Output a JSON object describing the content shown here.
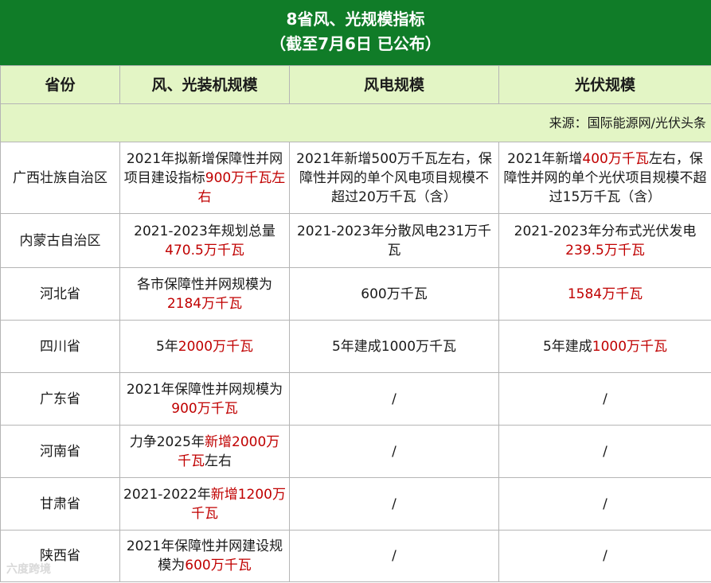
{
  "title_line1": "8省风、光规模指标",
  "title_line2": "（截至7月6日 已公布）",
  "columns": [
    "省份",
    "风、光装机规模",
    "风电规模",
    "光伏规模"
  ],
  "source": "来源：国际能源网/光伏头条",
  "rows": [
    {
      "province": "广西壮族自治区",
      "total": [
        {
          "t": "2021年拟新增保障性并网项目建设指标"
        },
        {
          "t": "900万千瓦左右",
          "red": true
        }
      ],
      "wind": [
        {
          "t": "2021年新增500万千瓦左右，保障性并网的单个风电项目规模不超过20万千瓦（含）"
        }
      ],
      "solar": [
        {
          "t": "2021年新增"
        },
        {
          "t": "400万千瓦",
          "red": true
        },
        {
          "t": "左右，保障性并网的单个光伏项目规模不超过15万千瓦（含）"
        }
      ]
    },
    {
      "province": "内蒙古自治区",
      "total": [
        {
          "t": "2021-2023年规划总量"
        },
        {
          "t": "470.5万千瓦",
          "red": true
        }
      ],
      "wind": [
        {
          "t": "2021-2023年分散风电231万千瓦"
        }
      ],
      "solar": [
        {
          "t": "2021-2023年分布式光伏发电"
        },
        {
          "t": "239.5万千瓦",
          "red": true
        }
      ]
    },
    {
      "province": "河北省",
      "total": [
        {
          "t": "各市保障性并网规模为"
        },
        {
          "t": "2184万千瓦",
          "red": true
        }
      ],
      "wind": [
        {
          "t": "600万千瓦"
        }
      ],
      "solar": [
        {
          "t": "1584万千瓦",
          "red": true
        }
      ]
    },
    {
      "province": "四川省",
      "total": [
        {
          "t": "5年"
        },
        {
          "t": "2000万千瓦",
          "red": true
        }
      ],
      "wind": [
        {
          "t": "5年建成1000万千瓦"
        }
      ],
      "solar": [
        {
          "t": "5年建成"
        },
        {
          "t": "1000万千瓦",
          "red": true
        }
      ]
    },
    {
      "province": "广东省",
      "total": [
        {
          "t": "2021年保障性并网规模为"
        },
        {
          "t": "900万千瓦",
          "red": true
        }
      ],
      "wind": [
        {
          "t": "/"
        }
      ],
      "solar": [
        {
          "t": "/"
        }
      ]
    },
    {
      "province": "河南省",
      "total": [
        {
          "t": "力争2025年"
        },
        {
          "t": "新增2000万千瓦",
          "red": true
        },
        {
          "t": "左右"
        }
      ],
      "wind": [
        {
          "t": "/"
        }
      ],
      "solar": [
        {
          "t": "/"
        }
      ]
    },
    {
      "province": "甘肃省",
      "total": [
        {
          "t": "2021-2022年"
        },
        {
          "t": "新增1200万千瓦",
          "red": true
        }
      ],
      "wind": [
        {
          "t": "/"
        }
      ],
      "solar": [
        {
          "t": "/"
        }
      ]
    },
    {
      "province": "陕西省",
      "total": [
        {
          "t": "2021年保障性并网建设规模为"
        },
        {
          "t": "600万千瓦",
          "red": true
        }
      ],
      "wind": [
        {
          "t": "/"
        }
      ],
      "solar": [
        {
          "t": "/"
        }
      ]
    }
  ],
  "watermark": "六度跨境",
  "colors": {
    "header_green": "#107c28",
    "light_green": "#e3f5c5",
    "highlight_red": "#c00000"
  }
}
